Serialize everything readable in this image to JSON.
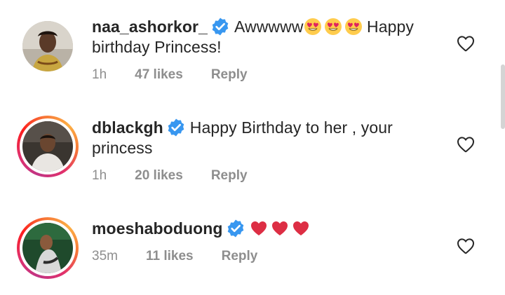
{
  "comments": [
    {
      "username": "naa_ashorkor_",
      "text_before": "Awwwww",
      "emojis": [
        "heart-eyes",
        "heart-eyes",
        "heart-eyes"
      ],
      "text_after": " Happy birthday Princess!",
      "time": "1h",
      "likes": "47 likes",
      "reply": "Reply"
    },
    {
      "username": "dblackgh",
      "text_before": "Happy Birthday to her , your princess",
      "emojis": [],
      "text_after": "",
      "time": "1h",
      "likes": "20 likes",
      "reply": "Reply"
    },
    {
      "username": "moeshaboduong",
      "text_before": "",
      "emojis": [
        "red-heart",
        "red-heart",
        "red-heart"
      ],
      "text_after": "",
      "time": "35m",
      "likes": "11 likes",
      "reply": "Reply"
    }
  ],
  "colors": {
    "text": "#262626",
    "secondary": "#8e8e8e",
    "verified": "#3897f0",
    "heart": "#ed4956"
  }
}
